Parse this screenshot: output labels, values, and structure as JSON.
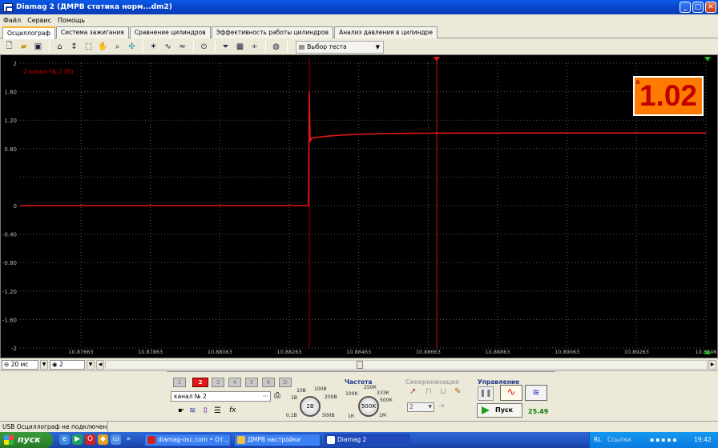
{
  "window": {
    "title": "Diamag 2 (ДМРВ статика норм...dm2)"
  },
  "menu": [
    "Файл",
    "Сервис",
    "Помощь"
  ],
  "tabs": [
    "Осциллограф",
    "Система зажигания",
    "Сравнение цилиндров",
    "Эффективность работы цилиндров",
    "Анализ давления в цилиндре"
  ],
  "active_tab": 0,
  "toolbar": {
    "test_select": "Выбор теста"
  },
  "scope": {
    "channel_label": "2 канал № 2 (В)",
    "readout_label": "В",
    "readout_value": "1.02",
    "y_ticks": [
      "2",
      "1.60",
      "1.20",
      "0.80",
      "0",
      "-0.40",
      "-0.80",
      "-1.20",
      "-1.60",
      "-2"
    ],
    "x_ticks": [
      "10.87663",
      "10.87863",
      "10.88063",
      "10.88263",
      "10.88463",
      "10.88663",
      "10.88863",
      "10.89063",
      "10.89263",
      "10.8946"
    ],
    "trace_color": "#e01818",
    "background": "#000000",
    "trace_levels": {
      "before_step": 0,
      "after_step": 1.02
    }
  },
  "bottom_controls": {
    "timebase": "20 мс",
    "channel_count": "2"
  },
  "panel": {
    "channels": [
      "1",
      "2",
      "3",
      "4",
      "5",
      "6",
      "D"
    ],
    "selected_channel": "2",
    "channel_name": "канал № 2",
    "voltage_knob": {
      "value": "2В",
      "labels": [
        "10В",
        "100В",
        "1В",
        "200В",
        "0,1В",
        "500В"
      ]
    },
    "freq_title": "Частота",
    "freq_knob": {
      "value": "500К",
      "labels": [
        "250К",
        "100К",
        "333К",
        "500К",
        "1К",
        "1М"
      ]
    },
    "sync_title": "Синхронизация",
    "sync_value": "2",
    "control_title": "Управление",
    "start_label": "Пуск",
    "timer": "25.49"
  },
  "status": {
    "text": "USB Осциллограф не подключен"
  },
  "taskbar": {
    "start": "пуск",
    "tasks": [
      "diamag-osc.com • От...",
      "ДМРВ настройки",
      "Diamag 2"
    ],
    "tray": {
      "lang": "RL",
      "links": "Ссылки",
      "time": "19:42"
    }
  }
}
